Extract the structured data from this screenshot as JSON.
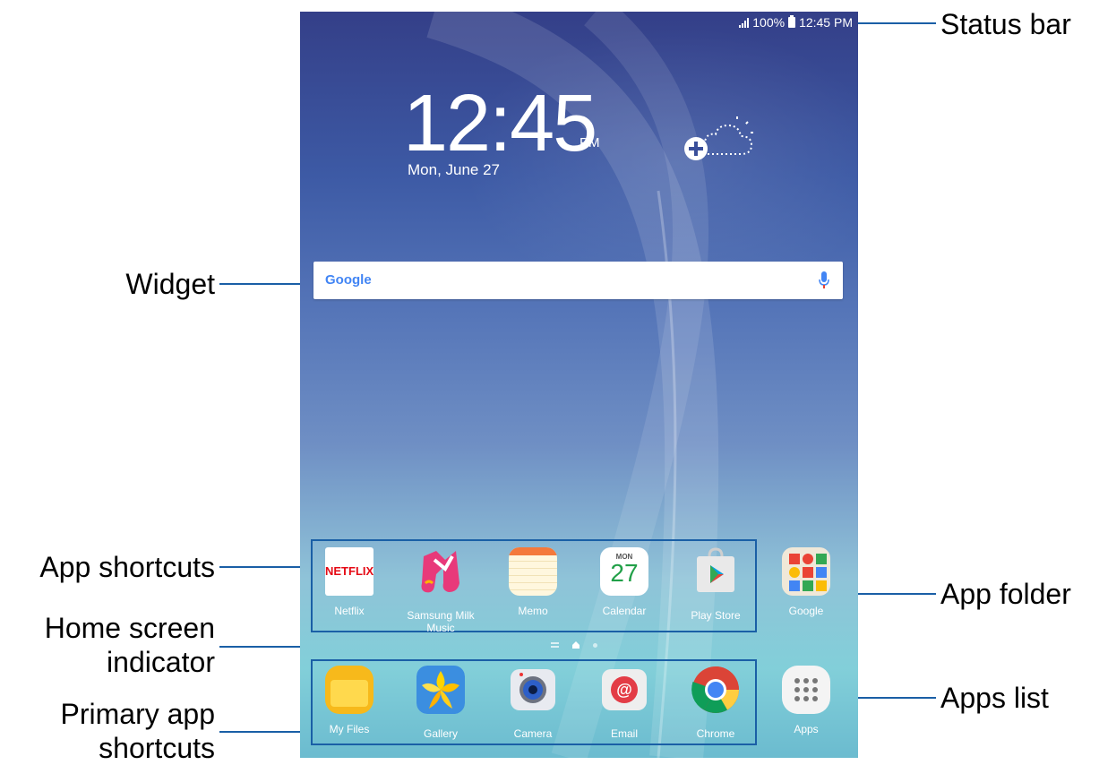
{
  "callouts": {
    "status_bar": "Status bar",
    "widget": "Widget",
    "app_shortcuts": "App shortcuts",
    "app_folder": "App folder",
    "home_indicator_1": "Home screen",
    "home_indicator_2": "indicator",
    "apps_list": "Apps list",
    "primary_1": "Primary app",
    "primary_2": "shortcuts"
  },
  "status": {
    "signal_icon": "signal-icon",
    "battery_level": "100%",
    "time": "12:45 PM"
  },
  "clock": {
    "time": "12:45",
    "ampm": "PM",
    "date": "Mon, June 27"
  },
  "search": {
    "logo": "Google"
  },
  "app_shortcuts": [
    {
      "label": "Netflix",
      "icon": "netflix-icon"
    },
    {
      "label": "Samsung Milk Music",
      "icon": "milk-music-icon"
    },
    {
      "label": "Memo",
      "icon": "memo-icon"
    },
    {
      "label": "Calendar",
      "icon": "calendar-icon",
      "day_name": "MON",
      "day_num": "27"
    },
    {
      "label": "Play Store",
      "icon": "play-store-icon"
    }
  ],
  "app_folder": {
    "label": "Google",
    "icon": "google-folder-icon"
  },
  "netflix_text": "NETFLIX",
  "primary_shortcuts": [
    {
      "label": "My Files",
      "icon": "my-files-icon"
    },
    {
      "label": "Gallery",
      "icon": "gallery-icon"
    },
    {
      "label": "Camera",
      "icon": "camera-icon"
    },
    {
      "label": "Email",
      "icon": "email-icon"
    },
    {
      "label": "Chrome",
      "icon": "chrome-icon"
    }
  ],
  "apps_list": {
    "label": "Apps",
    "icon": "apps-grid-icon"
  },
  "colors": {
    "callout_line": "#1a5fa6",
    "google_blue": "#4285f4"
  }
}
